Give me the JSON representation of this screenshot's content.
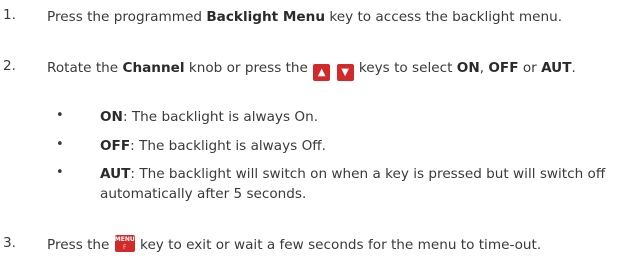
{
  "steps": [
    {
      "num": "1.",
      "pre": "Press the programmed ",
      "bold1": "Backlight Menu",
      "post": " key to access the backlight menu."
    },
    {
      "num": "2.",
      "pre": "Rotate the ",
      "bold1": "Channel",
      "mid": " knob or press the ",
      "up_key": "▲",
      "down_key": "▼",
      "mid2": " keys to select ",
      "on": "ON",
      "comma": ", ",
      "off": "OFF",
      "or": " or ",
      "aut": "AUT",
      "end": "."
    },
    {
      "num": "3.",
      "pre": "Press the ",
      "menu_key_top": "MENU",
      "menu_key_bottom": "F",
      "post": " key to exit or wait a few seconds for the menu to time-out."
    }
  ],
  "bullets": [
    {
      "dot": "•",
      "term": "ON",
      "desc": ": The backlight is always On."
    },
    {
      "dot": "•",
      "term": "OFF",
      "desc": ": The backlight is always Off."
    },
    {
      "dot": "•",
      "term": "AUT",
      "desc": ": The backlight will switch on when a key is pressed but will switch off automatically after 5 seconds."
    }
  ],
  "colors": {
    "text": "#3a3a3a",
    "key_bg": "#d22a2a"
  },
  "icons": [
    "up-arrow-key-icon",
    "down-arrow-key-icon",
    "menu-key-icon"
  ]
}
